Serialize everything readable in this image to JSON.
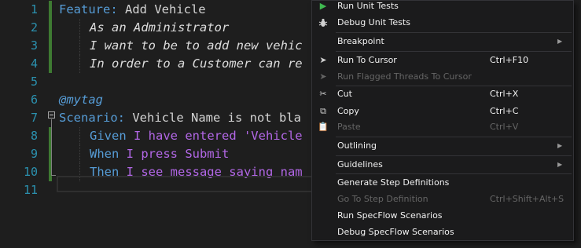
{
  "editor": {
    "line_numbers": [
      "1",
      "2",
      "3",
      "4",
      "5",
      "6",
      "7",
      "8",
      "9",
      "10",
      "11"
    ],
    "lines": {
      "l1_kw": "Feature:",
      "l1_txt": " Add Vehicle",
      "l2": "As an Administrator",
      "l3": "I want to be to add new vehic",
      "l4": "In order to a Customer can re",
      "l6": "@mytag",
      "l7_kw": "Scenario:",
      "l7_txt": " Vehicle Name is not bla",
      "l8_kw": "Given",
      "l8_txt": " I have entered 'Vehicle",
      "l9_kw": "When",
      "l9_txt": " I press Submit",
      "l10_kw": "Then",
      "l10_txt": " I see message saying nam"
    }
  },
  "context_menu": {
    "run_unit_tests": "Run Unit Tests",
    "debug_unit_tests": "Debug Unit Tests",
    "breakpoint": "Breakpoint",
    "run_to_cursor": "Run To Cursor",
    "run_to_cursor_shortcut": "Ctrl+F10",
    "run_flagged_threads": "Run Flagged Threads To Cursor",
    "cut": "Cut",
    "cut_shortcut": "Ctrl+X",
    "copy": "Copy",
    "copy_shortcut": "Ctrl+C",
    "paste": "Paste",
    "paste_shortcut": "Ctrl+V",
    "outlining": "Outlining",
    "guidelines": "Guidelines",
    "generate_step_definitions": "Generate Step Definitions",
    "go_to_step_definition": "Go To Step Definition",
    "go_to_step_definition_shortcut": "Ctrl+Shift+Alt+S",
    "run_specflow_scenarios": "Run SpecFlow Scenarios",
    "debug_specflow_scenarios": "Debug SpecFlow Scenarios"
  },
  "icons": {
    "play": "play-icon",
    "bug": "bug-icon",
    "cursor": "cursor-arrow-icon",
    "scissors": "scissors-icon",
    "copy": "copy-icon",
    "paste": "paste-icon"
  },
  "colors": {
    "editor_bg": "#1e1e1e",
    "keyword": "#569cd6",
    "step_text": "#b267e6",
    "line_number": "#2b91af",
    "change_bar": "#3e7a32",
    "menu_bg": "#1b1b1c"
  }
}
